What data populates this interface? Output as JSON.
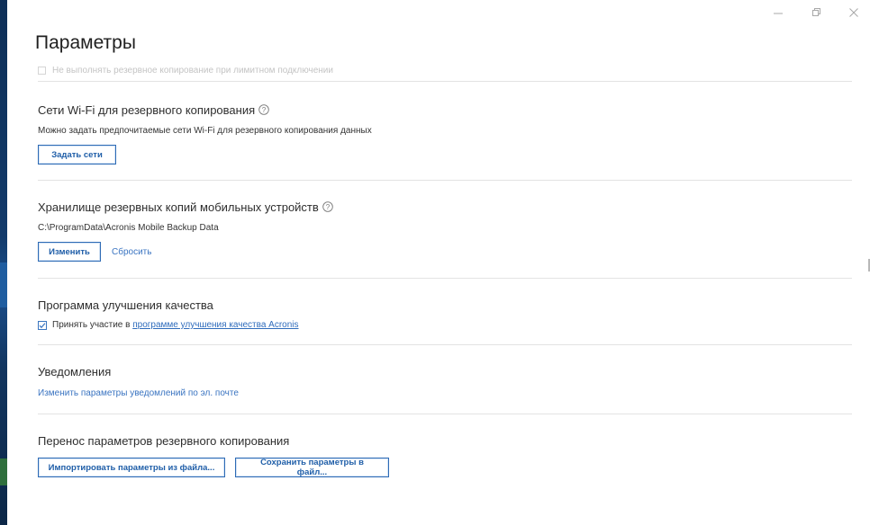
{
  "window": {
    "title": "Параметры",
    "controls": [
      {
        "name": "minimize",
        "icon": "minimize-icon"
      },
      {
        "name": "restore",
        "icon": "restore-icon"
      },
      {
        "name": "close",
        "icon": "close-icon"
      }
    ]
  },
  "cut_off_option": {
    "label": "Не выполнять резервное копирование при лимитном подключении",
    "checked": false
  },
  "wifi": {
    "title": "Сети Wi-Fi для резервного копирования",
    "description": "Можно задать предпочитаемые сети Wi-Fi для резервного копирования данных",
    "button": "Задать сети"
  },
  "mobile_storage": {
    "title": "Хранилище резервных копий мобильных устройств",
    "path": "C:\\ProgramData\\Acronis Mobile Backup Data",
    "change_button": "Изменить",
    "reset_link": "Сбросить"
  },
  "quality": {
    "title": "Программа улучшения качества",
    "checkbox_prefix": "Принять участие в ",
    "checkbox_link": "программе улучшения качества Acronis",
    "checked": true
  },
  "notifications": {
    "title": "Уведомления",
    "link": "Изменить параметры уведомлений по эл. почте"
  },
  "transfer": {
    "title": "Перенос параметров резервного копирования",
    "import_button": "Импортировать параметры из файла...",
    "save_button": "Сохранить параметры в файл..."
  },
  "colors": {
    "accent": "#2e6bb5",
    "link": "#3a74c1",
    "sidebar": "#123a6a"
  }
}
